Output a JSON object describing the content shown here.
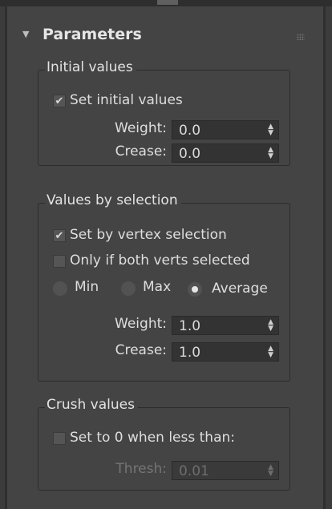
{
  "panel": {
    "title": "Parameters"
  },
  "initial_values": {
    "group_title": "Initial values",
    "set_initial_label": "Set initial values",
    "set_initial_checked": true,
    "weight_label": "Weight:",
    "weight_value": "0.0",
    "crease_label": "Crease:",
    "crease_value": "0.0"
  },
  "values_by_selection": {
    "group_title": "Values by selection",
    "set_by_vertex_label": "Set by vertex selection",
    "set_by_vertex_checked": true,
    "only_both_label": "Only if both verts selected",
    "only_both_checked": false,
    "radio_min_label": "Min",
    "radio_max_label": "Max",
    "radio_average_label": "Average",
    "selected_mode": "Average",
    "weight_label": "Weight:",
    "weight_value": "1.0",
    "crease_label": "Crease:",
    "crease_value": "1.0"
  },
  "crush_values": {
    "group_title": "Crush values",
    "set_zero_label": "Set to 0 when less than:",
    "set_zero_checked": false,
    "thresh_label": "Thresh:",
    "thresh_value": "0.01"
  },
  "icons": {
    "collapse": "triangle-down",
    "spinner": "up-down-arrows",
    "check": "checkmark"
  }
}
